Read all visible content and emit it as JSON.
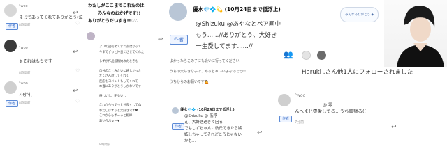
{
  "panel1": {
    "comments": [
      {
        "handle": "°woo",
        "badge": "作者",
        "text": "まじであってくれてありがとう(泣",
        "meta": "8時間前"
      },
      {
        "handle": "°woo",
        "badge": "",
        "text": "ぁそれはもちです",
        "meta": "8時間前"
      },
      {
        "handle": "°woo",
        "badge": "作者",
        "text": "사랑해(",
        "meta": "8時間前"
      }
    ]
  },
  "panel2": {
    "heading": [
      "わたしがここまでこれたのは",
      "みんなのおかげです!!",
      "ありがとうだいすき!!♡♡"
    ],
    "letter": [
      "アリの読初めてすぐ友達なって",
      "今までずっと仲良くさせてくれた",
      "しずが作品投稿始めたときも",
      "自分のことみたいに嬉しかった",
      "たくさん話してくれて",
      "反応もコメントもしてくれて",
      "本当にありがとうしかないです",
      "優しいし、明るいし",
      "これからもずっと仲良くしてね",
      "わたしはずっと大好きです♥",
      "これからもずーっと相棒",
      "あいらぶゅー♥"
    ],
    "meta": "8時間前"
  },
  "panel3": {
    "name": "優水💎💠💫  (10月24日まで低浮上)",
    "badge": "作者",
    "handle_line": "@Shizuku @あやなとペア画中",
    "text_lines": [
      "もう......//ありがとう、大好き",
      "一生愛してます......//"
    ],
    "replies": [
      "よかったらこの子にも会いに行ってください",
      "うちの大好きな子で、めっちゃいい子なので😊!!",
      "うちからのお願いです🙇"
    ],
    "nested": {
      "name": "優水💎💠 (10月24日まで低浮上)",
      "badge": "作者",
      "handle": "@Shizuku @ 低浮",
      "lines": [
        "え、大好き過ぎて困る",
        "でもしずちゃんに彼氏できたら嫉",
        "妬しちゃってそれどころじゃない",
        "かも..."
      ]
    }
  },
  "panel4": {
    "speech_bubble": "みんなありがとう ◆",
    "notification": "Haruki .さん他1人にフォローされました",
    "comment": {
      "handle": "°woo",
      "mention": "@ 零",
      "text": "んへまじ零愛してる...うち頑張る((",
      "meta": "7分前"
    }
  },
  "colors": {
    "badge": "#3b6fc9",
    "text": "#222222",
    "muted": "#999999"
  }
}
